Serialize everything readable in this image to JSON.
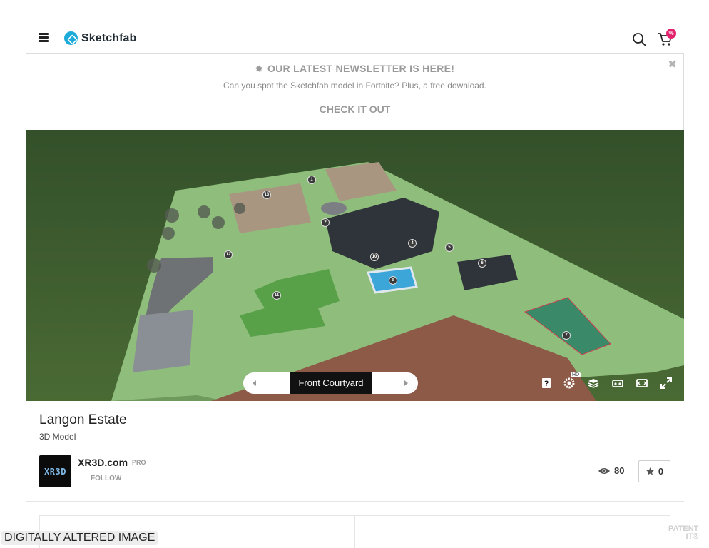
{
  "header": {
    "brand": "Sketchfab",
    "menu_icon": "hamburger-menu-icon",
    "search_icon": "search-icon",
    "cart_icon": "cart-icon",
    "cart_badge": "%"
  },
  "banner": {
    "title": "OUR LATEST NEWSLETTER IS HERE!",
    "subtitle": "Can you spot the Sketchfab model in Fortnite? Plus, a free download.",
    "cta": "CHECK IT OUT",
    "close_label": "✖"
  },
  "viewer": {
    "annotation_label": "Front Courtyard",
    "annotations": [
      "1",
      "2",
      "4",
      "5",
      "6",
      "7",
      "9",
      "10",
      "11",
      "12",
      "13"
    ],
    "hd_badge": "HD",
    "controls": [
      "help-icon",
      "settings-icon",
      "layers-icon",
      "vr-icon",
      "theater-icon",
      "fullscreen-icon"
    ],
    "colors": {
      "grass": "#3f5e2c",
      "lawn": "#8fbf7a",
      "roof": "#2f333a",
      "pool": "#3da6d9"
    }
  },
  "model": {
    "title": "Langon Estate",
    "type": "3D Model"
  },
  "author": {
    "avatar_text": "XR3D",
    "name": "XR3D.com",
    "badge": "PRO",
    "follow_label": "FOLLOW"
  },
  "stats": {
    "views": "80",
    "likes": "0"
  },
  "watermark": "DIGITALLY ALTERED IMAGE",
  "corner_mark": "PATENT\nIT®"
}
